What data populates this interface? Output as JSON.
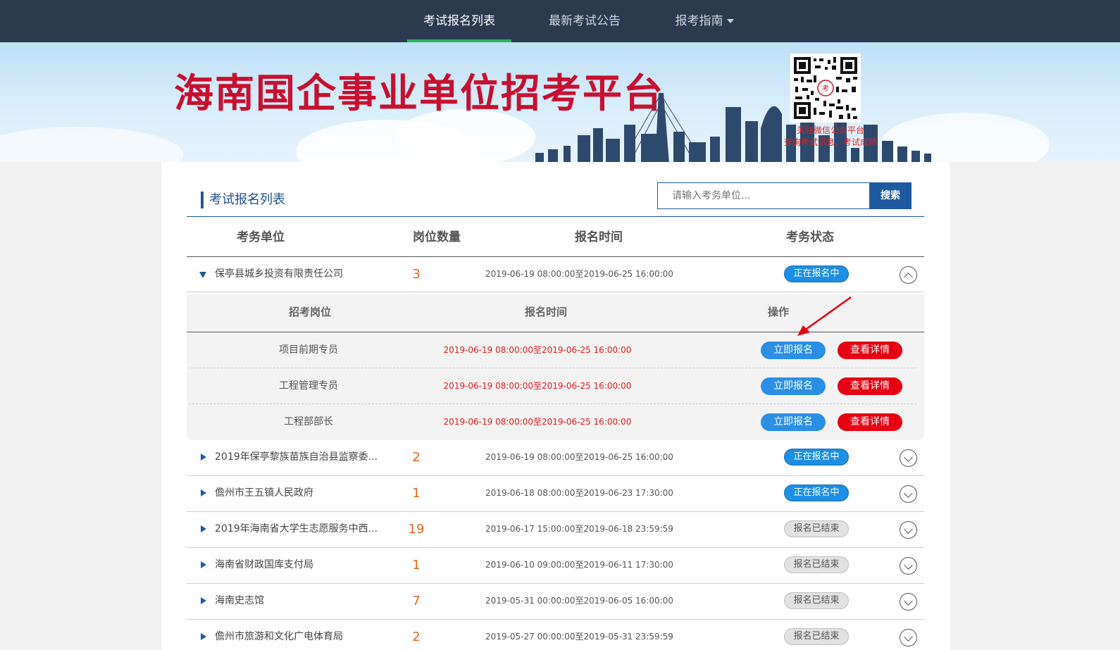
{
  "nav": {
    "items": [
      {
        "label": "考试报名列表"
      },
      {
        "label": "最新考试公告"
      },
      {
        "label": "报考指南"
      }
    ]
  },
  "banner": {
    "title": "海南国企事业单位招考平台",
    "qr_caption_line1": "关注微信公众平台",
    "qr_caption_line2": "查询考试讯息、考试成绩"
  },
  "section": {
    "title": "考试报名列表",
    "search_placeholder": "请输入考务单位...",
    "search_button": "搜索"
  },
  "columns": [
    "考务单位",
    "岗位数量",
    "报名时间",
    "考务状态"
  ],
  "sub_columns": [
    "招考岗位",
    "报名时间",
    "操作"
  ],
  "rows": [
    {
      "unit": "保亭县城乡投资有限责任公司",
      "count": "3",
      "time": "2019-06-19 08:00:00至2019-06-25 16:00:00",
      "status": "正在报名中"
    },
    {
      "unit": "2019年保亭黎族苗族自治县监察委...",
      "count": "2",
      "time": "2019-06-19 08:00:00至2019-06-25 16:00:00",
      "status": "正在报名中"
    },
    {
      "unit": "儋州市王五镇人民政府",
      "count": "1",
      "time": "2019-06-18 08:00:00至2019-06-23 17:30:00",
      "status": "正在报名中"
    },
    {
      "unit": "2019年海南省大学生志愿服务中西...",
      "count": "19",
      "time": "2019-06-17 15:00:00至2019-06-18 23:59:59",
      "status": "报名已结束"
    },
    {
      "unit": "海南省财政国库支付局",
      "count": "1",
      "time": "2019-06-10 09:00:00至2019-06-11 17:30:00",
      "status": "报名已结束"
    },
    {
      "unit": "海南史志馆",
      "count": "7",
      "time": "2019-05-31 00:00:00至2019-06-05 16:00:00",
      "status": "报名已结束"
    },
    {
      "unit": "儋州市旅游和文化广电体育局",
      "count": "2",
      "time": "2019-05-27 00:00:00至2019-05-31 23:59:59",
      "status": "报名已结束"
    }
  ],
  "positions": [
    {
      "job": "项目前期专员",
      "time": "2019-06-19 08:00:00至2019-06-25 16:00:00",
      "apply": "立即报名",
      "detail": "查看详情"
    },
    {
      "job": "工程管理专员",
      "time": "2019-06-19 08:00:00至2019-06-25 16:00:00",
      "apply": "立即报名",
      "detail": "查看详情"
    },
    {
      "job": "工程部部长",
      "time": "2019-06-19 08:00:00至2019-06-25 16:00:00",
      "apply": "立即报名",
      "detail": "查看详情"
    }
  ],
  "colors": {
    "nav_bg": "#2b3a4f",
    "nav_active_underline": "#2eb25c",
    "brand_blue": "#1e5aa0",
    "title_red": "#c8102e",
    "status_open": "#1d8fe4",
    "status_closed": "#e2e2e2",
    "count_orange": "#e8651c",
    "detail_red": "#e60012"
  }
}
